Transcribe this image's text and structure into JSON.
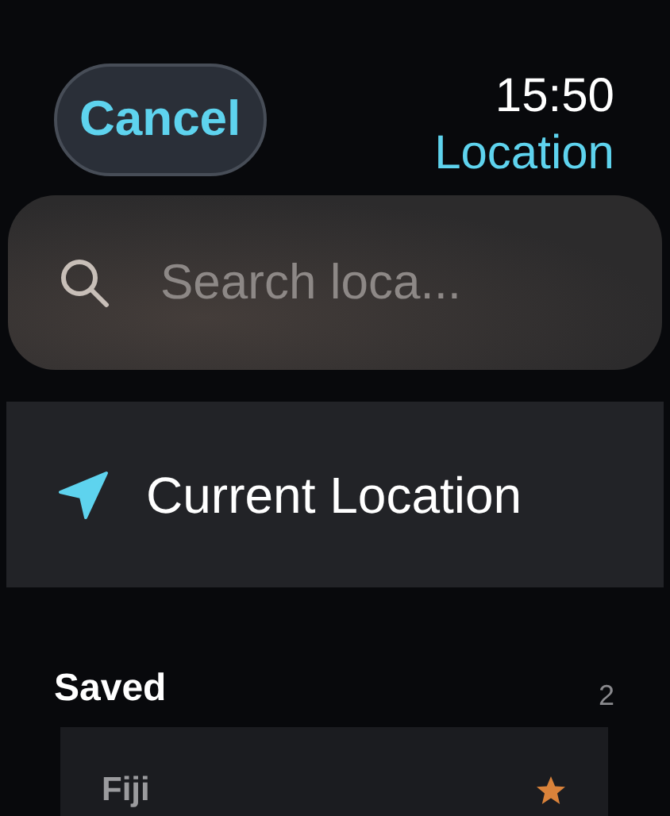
{
  "header": {
    "cancel_button": "Cancel",
    "time": "15:50",
    "title": "Location"
  },
  "search": {
    "placeholder": "Search loca..."
  },
  "current_location": {
    "label": "Current Location"
  },
  "saved": {
    "heading": "Saved",
    "count": "2",
    "items": [
      {
        "name": "Fiji",
        "favorite": true
      }
    ]
  }
}
